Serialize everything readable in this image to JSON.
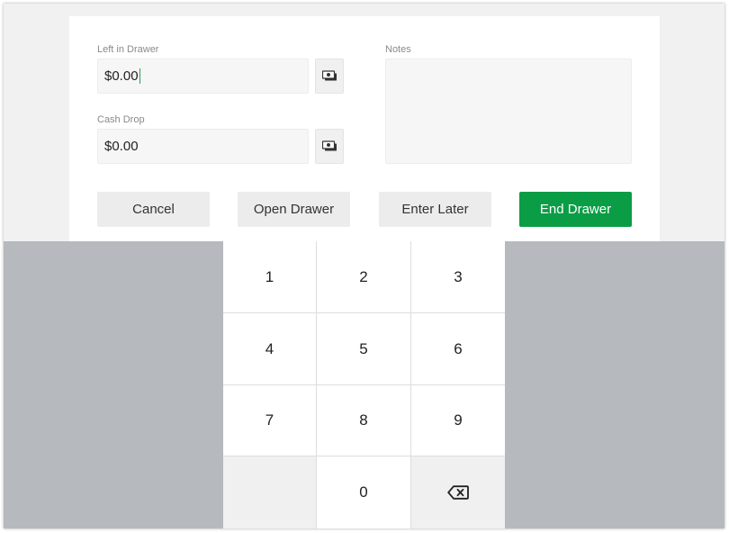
{
  "form": {
    "left_in_drawer": {
      "label": "Left in Drawer",
      "value": "$0.00"
    },
    "cash_drop": {
      "label": "Cash Drop",
      "value": "$0.00"
    },
    "notes": {
      "label": "Notes",
      "value": ""
    },
    "cash_icon": "cash-icon"
  },
  "actions": {
    "cancel": "Cancel",
    "open_drawer": "Open Drawer",
    "enter_later": "Enter Later",
    "end_drawer": "End Drawer"
  },
  "keypad": {
    "keys": [
      "1",
      "2",
      "3",
      "4",
      "5",
      "6",
      "7",
      "8",
      "9",
      "",
      "0"
    ],
    "delete_icon": "backspace-icon"
  },
  "colors": {
    "primary": "#0b9d45",
    "caret": "#2e9e55",
    "keypad_background": "#b6b9bd"
  }
}
